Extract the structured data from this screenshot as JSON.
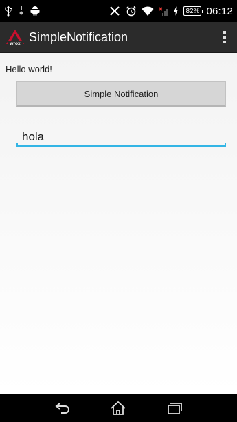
{
  "status_bar": {
    "battery_percent": "82%",
    "time": "06:12",
    "icons": [
      "usb-icon",
      "notification-dot-icon",
      "android-icon",
      "nfc-off-icon",
      "alarm-icon",
      "wifi-icon",
      "no-signal-icon",
      "charging-icon",
      "battery-icon"
    ]
  },
  "action_bar": {
    "app_logo": "wrox-logo",
    "title": "SimpleNotification",
    "overflow_icon": "overflow-menu-icon"
  },
  "main": {
    "hello_text": "Hello world!",
    "notify_button_label": "Simple Notification",
    "text_field_value": "hola",
    "accent_color": "#33b5e5"
  },
  "nav_bar": {
    "icons": [
      "back-icon",
      "home-icon",
      "recents-icon"
    ]
  }
}
